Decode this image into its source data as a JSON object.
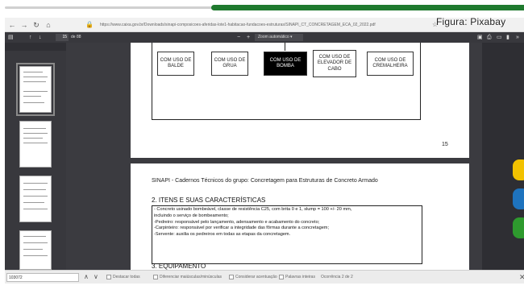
{
  "browser": {
    "url": "https://www.caixa.gov.br/Downloads/sinapi-composicoes-aferidas-lote1-habitacao-fundacoes-estruturas/SINAPI_CT_CONCRETAGEM_ECA_02_2022.pdf",
    "watermark": "Figura: Pixabay"
  },
  "pdf_toolbar": {
    "page_current": "15",
    "page_total": "de 88",
    "zoom_label": "Zoom automático"
  },
  "page1": {
    "boxes": [
      "COM USO DE BALDE",
      "COM USO DE GRUA",
      "COM USO DE BOMBA",
      "COM USO DE ELEVADOR DE CABO",
      "COM USO DE CREMALHEIRA"
    ],
    "page_number": "15"
  },
  "page2": {
    "header": "SINAPI - Cadernos Técnicos do grupo: Concretagem para Estruturas de Concreto Armado",
    "section_title": "2. ITENS E SUAS CARACTERÍSTICAS",
    "lines": [
      "- Concreto usinado bombeável, classe de resistência C25, com brita 0 e 1, slump = 100 +/- 20 mm,",
      "incluindo o serviço de bombeamento;",
      "-Pedreiro: responsável pelo lançamento, adensamento e acabamento do concreto;",
      "-Carpinteiro: responsável por verificar a integridade das fôrmas durante a concretagem;",
      "-Servente: auxilia os pedreiros em todas as etapas da concretagem."
    ],
    "section3": "3. EQUIPAMENTO"
  },
  "find_bar": {
    "query": "103072",
    "highlight_all": "Destacar todas",
    "match_case": "Diferenciar maiúsculas/minúsculas",
    "match_diacritics": "Considerar acentuação",
    "whole_words": "Palavras inteiras",
    "result": "Ocorrência 2 de 2"
  },
  "colors": {
    "accent_green": "#1f7a2e",
    "dot_yellow": "#f2c200",
    "dot_blue": "#1e73be",
    "dot_green": "#2e9a2e"
  }
}
